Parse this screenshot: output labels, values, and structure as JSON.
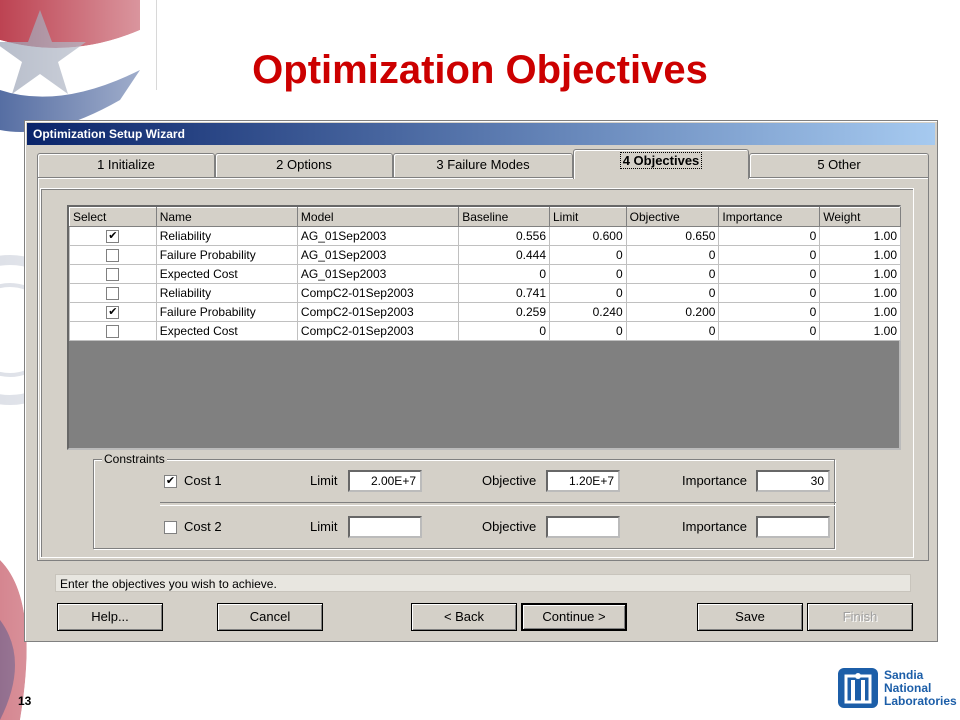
{
  "slide": {
    "title": "Optimization Objectives",
    "page_number": "13",
    "logo_text": [
      "Sandia",
      "National",
      "Laboratories"
    ]
  },
  "dialog": {
    "title": "Optimization Setup Wizard",
    "tabs": [
      {
        "label": "1 Initialize",
        "active": false
      },
      {
        "label": "2 Options",
        "active": false
      },
      {
        "label": "3 Failure Modes",
        "active": false
      },
      {
        "label": "4 Objectives",
        "active": true
      },
      {
        "label": "5 Other",
        "active": false
      }
    ],
    "grid": {
      "columns": [
        "Select",
        "Name",
        "Model",
        "Baseline",
        "Limit",
        "Objective",
        "Importance",
        "Weight"
      ],
      "rows": [
        {
          "selected": true,
          "name": "Reliability",
          "model": "AG_01Sep2003",
          "baseline": "0.556",
          "limit": "0.600",
          "objective": "0.650",
          "importance": "0",
          "weight": "1.00"
        },
        {
          "selected": false,
          "name": "Failure Probability",
          "model": "AG_01Sep2003",
          "baseline": "0.444",
          "limit": "0",
          "objective": "0",
          "importance": "0",
          "weight": "1.00"
        },
        {
          "selected": false,
          "name": "Expected Cost",
          "model": "AG_01Sep2003",
          "baseline": "0",
          "limit": "0",
          "objective": "0",
          "importance": "0",
          "weight": "1.00"
        },
        {
          "selected": false,
          "name": "Reliability",
          "model": "CompC2-01Sep2003",
          "baseline": "0.741",
          "limit": "0",
          "objective": "0",
          "importance": "0",
          "weight": "1.00"
        },
        {
          "selected": true,
          "name": "Failure Probability",
          "model": "CompC2-01Sep2003",
          "baseline": "0.259",
          "limit": "0.240",
          "objective": "0.200",
          "importance": "0",
          "weight": "1.00"
        },
        {
          "selected": false,
          "name": "Expected Cost",
          "model": "CompC2-01Sep2003",
          "baseline": "0",
          "limit": "0",
          "objective": "0",
          "importance": "0",
          "weight": "1.00"
        }
      ]
    },
    "constraints": {
      "legend": "Constraints",
      "limit_label": "Limit",
      "objective_label": "Objective",
      "importance_label": "Importance",
      "items": [
        {
          "label": "Cost 1",
          "checked": true,
          "limit": "2.00E+7",
          "objective": "1.20E+7",
          "importance": "30"
        },
        {
          "label": "Cost 2",
          "checked": false,
          "limit": "",
          "objective": "",
          "importance": ""
        }
      ]
    },
    "status_text": "Enter the objectives you wish to achieve.",
    "buttons": {
      "help": "Help...",
      "cancel": "Cancel",
      "back": "< Back",
      "continue": "Continue >",
      "save": "Save",
      "finish": "Finish"
    }
  },
  "colors": {
    "title_red": "#cc0000",
    "titlebar_start": "#0a246a",
    "titlebar_end": "#a6caf0",
    "dialog_face": "#d4d0c8",
    "sandia_blue": "#1c5ea8"
  }
}
